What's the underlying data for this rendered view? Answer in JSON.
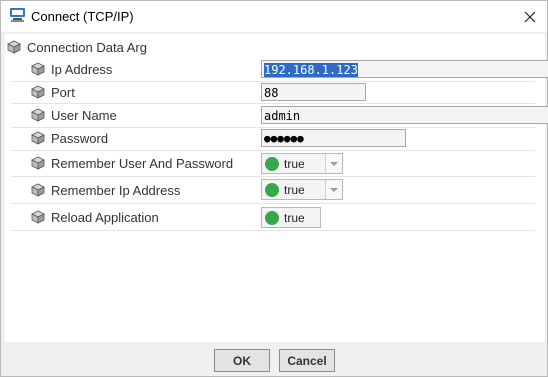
{
  "window": {
    "title": "Connect (TCP/IP)",
    "app_icon": "app-icon",
    "close_icon": "close-icon"
  },
  "group": {
    "label": "Connection Data Arg"
  },
  "rows": [
    {
      "label": "Ip Address",
      "type": "text",
      "value": "192.168.1.123",
      "selected": true
    },
    {
      "label": "Port",
      "type": "text",
      "value": "88"
    },
    {
      "label": "User Name",
      "type": "text",
      "value": "admin"
    },
    {
      "label": "Password",
      "type": "password",
      "value": "●●●●●●"
    },
    {
      "label": "Remember User And Password",
      "type": "dropdown",
      "value": "true"
    },
    {
      "label": "Remember Ip Address",
      "type": "dropdown",
      "value": "true"
    },
    {
      "label": "Reload Application",
      "type": "toggle",
      "value": "true"
    }
  ],
  "buttons": {
    "ok": "OK",
    "cancel": "Cancel"
  },
  "colors": {
    "status_green": "#3aa64c",
    "selection_blue": "#2d6bc6"
  }
}
